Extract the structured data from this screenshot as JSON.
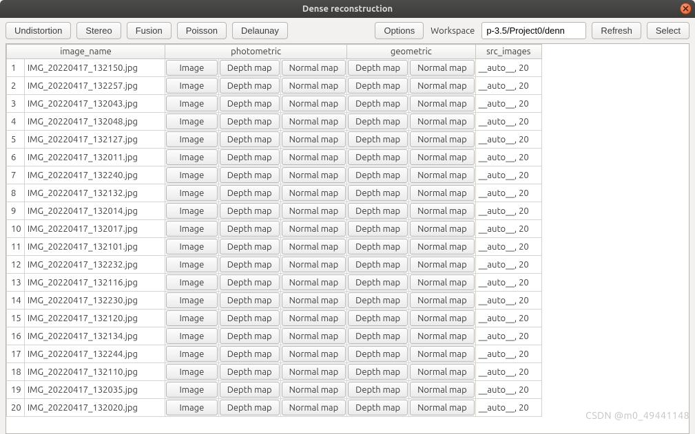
{
  "window": {
    "title": "Dense reconstruction"
  },
  "toolbar": {
    "undistortion": "Undistortion",
    "stereo": "Stereo",
    "fusion": "Fusion",
    "poisson": "Poisson",
    "delaunay": "Delaunay",
    "options": "Options",
    "workspace_label": "Workspace",
    "workspace_value": "p-3.5/Project0/denn",
    "refresh": "Refresh",
    "select": "Select"
  },
  "headers": {
    "image_name": "image_name",
    "photometric": "photometric",
    "geometric": "geometric",
    "src_images": "src_images"
  },
  "cellbtns": {
    "image": "Image",
    "depth": "Depth map",
    "normal": "Normal map"
  },
  "rows": [
    {
      "n": "1",
      "name": "IMG_20220417_132150.jpg",
      "src": "__auto__, 20"
    },
    {
      "n": "2",
      "name": "IMG_20220417_132257.jpg",
      "src": "__auto__, 20"
    },
    {
      "n": "3",
      "name": "IMG_20220417_132043.jpg",
      "src": "__auto__, 20"
    },
    {
      "n": "4",
      "name": "IMG_20220417_132048.jpg",
      "src": "__auto__, 20"
    },
    {
      "n": "5",
      "name": "IMG_20220417_132127.jpg",
      "src": "__auto__, 20"
    },
    {
      "n": "6",
      "name": "IMG_20220417_132011.jpg",
      "src": "__auto__, 20"
    },
    {
      "n": "7",
      "name": "IMG_20220417_132240.jpg",
      "src": "__auto__, 20"
    },
    {
      "n": "8",
      "name": "IMG_20220417_132132.jpg",
      "src": "__auto__, 20"
    },
    {
      "n": "9",
      "name": "IMG_20220417_132014.jpg",
      "src": "__auto__, 20"
    },
    {
      "n": "10",
      "name": "IMG_20220417_132017.jpg",
      "src": "__auto__, 20"
    },
    {
      "n": "11",
      "name": "IMG_20220417_132101.jpg",
      "src": "__auto__, 20"
    },
    {
      "n": "12",
      "name": "IMG_20220417_132232.jpg",
      "src": "__auto__, 20"
    },
    {
      "n": "13",
      "name": "IMG_20220417_132116.jpg",
      "src": "__auto__, 20"
    },
    {
      "n": "14",
      "name": "IMG_20220417_132230.jpg",
      "src": "__auto__, 20"
    },
    {
      "n": "15",
      "name": "IMG_20220417_132120.jpg",
      "src": "__auto__, 20"
    },
    {
      "n": "16",
      "name": "IMG_20220417_132134.jpg",
      "src": "__auto__, 20"
    },
    {
      "n": "17",
      "name": "IMG_20220417_132244.jpg",
      "src": "__auto__, 20"
    },
    {
      "n": "18",
      "name": "IMG_20220417_132110.jpg",
      "src": "__auto__, 20"
    },
    {
      "n": "19",
      "name": "IMG_20220417_132035.jpg",
      "src": "__auto__, 20"
    },
    {
      "n": "20",
      "name": "IMG_20220417_132020.jpg",
      "src": "__auto__, 20"
    }
  ],
  "watermark": "CSDN @m0_49441148"
}
